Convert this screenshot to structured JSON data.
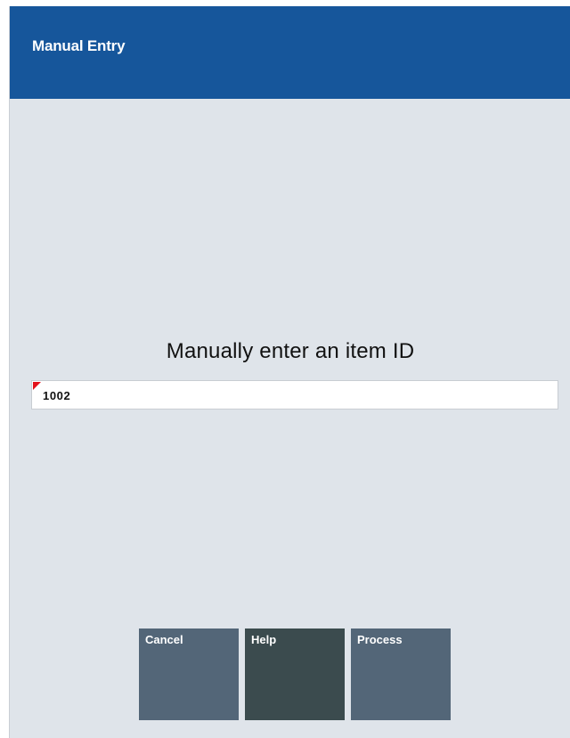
{
  "header": {
    "title": "Manual Entry"
  },
  "main": {
    "prompt": "Manually enter an item ID",
    "item_id_value": "1002"
  },
  "buttons": {
    "cancel_label": "Cancel",
    "help_label": "Help",
    "process_label": "Process"
  },
  "colors": {
    "header_bg": "#16569b",
    "screen_bg": "#dfe4ea",
    "button_bg": "#536678",
    "help_button_bg": "#3b4b4e",
    "required_flag": "#e3121b"
  },
  "icons": {
    "required_indicator": "red-corner-triangle-icon"
  }
}
